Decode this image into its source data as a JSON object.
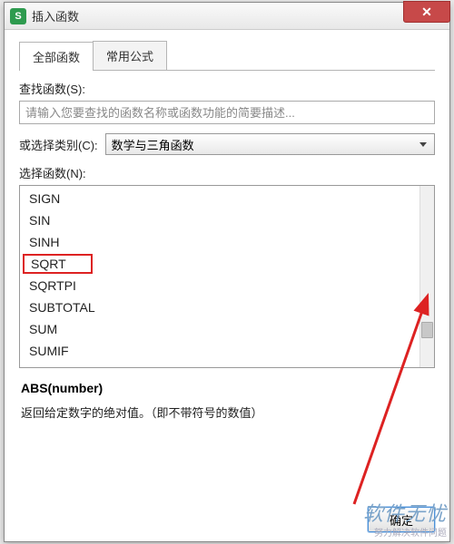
{
  "window": {
    "title": "插入函数",
    "icon_letter": "S"
  },
  "tabs": [
    {
      "label": "全部函数",
      "active": true
    },
    {
      "label": "常用公式",
      "active": false
    }
  ],
  "search": {
    "label": "查找函数(S):",
    "placeholder": "请输入您要查找的函数名称或函数功能的简要描述..."
  },
  "category": {
    "label": "或选择类别(C):",
    "selected": "数学与三角函数"
  },
  "function_list": {
    "label": "选择函数(N):",
    "items": [
      "SIGN",
      "SIN",
      "SINH",
      "SQRT",
      "SQRTPI",
      "SUBTOTAL",
      "SUM",
      "SUMIF"
    ],
    "highlighted": "SQRT"
  },
  "description": {
    "signature": "ABS(number)",
    "text": "返回给定数字的绝对值。（即不带符号的数值）"
  },
  "buttons": {
    "ok": "确定"
  },
  "watermark": {
    "main": "软件无忧",
    "sub": "努力解决软件问题"
  }
}
